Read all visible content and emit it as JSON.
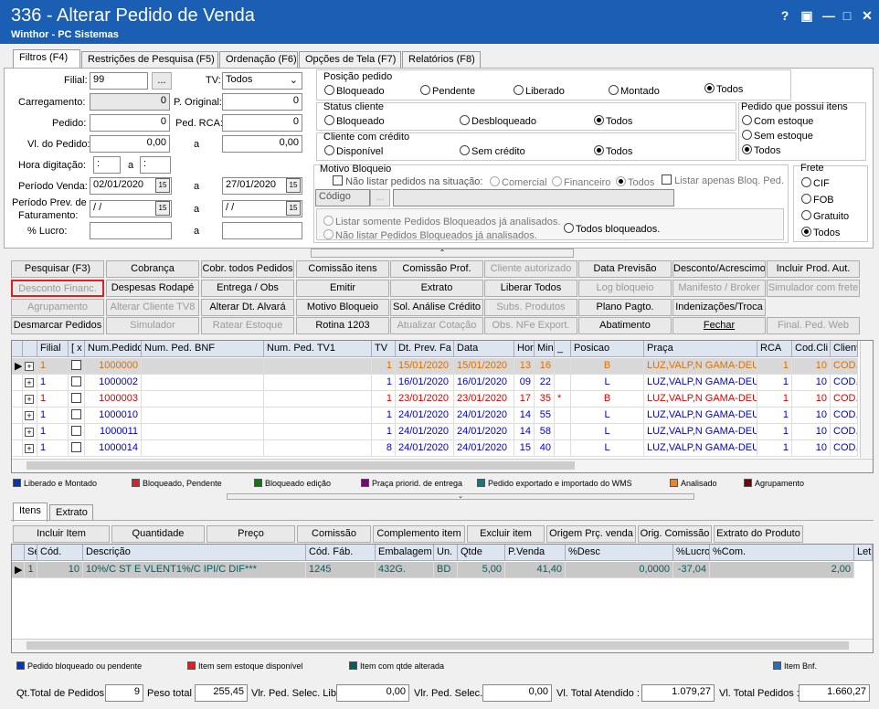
{
  "window": {
    "title": "336 - Alterar Pedido de Venda",
    "subtitle": "Winthor - PC Sistemas",
    "btn_help": "?",
    "btn_restore": "▣",
    "btn_min": "—",
    "btn_max": "□",
    "btn_close": "✕"
  },
  "tabs": [
    "Filtros (F4)",
    "Restrições de Pesquisa (F5)",
    "Ordenação (F6)",
    "Opções de Tela (F7)",
    "Relatórios (F8)"
  ],
  "filters": {
    "filial_label": "Filial:",
    "filial_value": "99",
    "filial_btn": "...",
    "tv_label": "TV:",
    "tv_value": "Todos",
    "carregamento_label": "Carregamento:",
    "carregamento_value": "0",
    "poriginal_label": "P. Original:",
    "poriginal_value": "0",
    "pedido_label": "Pedido:",
    "pedido_value": "0",
    "pedrca_label": "Ped. RCA:",
    "pedrca_value": "0",
    "vlpedido_label": "Vl. do Pedido:",
    "vlpedido_from": "0,00",
    "vlpedido_to": "0,00",
    "a": "a",
    "hora_label": "Hora digitação:",
    "hora_from": ":",
    "hora_to": ":",
    "periodo_label": "Período Venda:",
    "periodo_from": "02/01/2020",
    "periodo_to": "27/01/2020",
    "prev_label1": "Período Prev. de",
    "prev_label2": "Faturamento:",
    "prev_from": "/ /",
    "prev_to": "/ /",
    "lucro_label": "% Lucro:"
  },
  "posicao": {
    "title": "Posição pedido",
    "options": [
      "Bloqueado",
      "Pendente",
      "Liberado",
      "Montado",
      "Todos"
    ],
    "selected": 4
  },
  "status_cliente": {
    "title": "Status cliente",
    "options": [
      "Bloqueado",
      "Desbloqueado",
      "Todos"
    ]
  },
  "credito": {
    "title": "Cliente com crédito",
    "options": [
      "Disponível",
      "Sem crédito",
      "Todos"
    ]
  },
  "possui_itens": {
    "title": "Pedido que possui itens",
    "options": [
      "Com estoque",
      "Sem estoque",
      "Todos"
    ]
  },
  "motivo": {
    "title": "Motivo Bloqueio",
    "nao_listar": "Não listar pedidos na situação:",
    "opts": [
      "Comercial",
      "Financeiro",
      "Todos"
    ],
    "listar_apenas": "Listar apenas Bloq. Ped.",
    "codigo": "Código",
    "btn": "...",
    "somente": "Listar somente Pedidos Bloqueados já analisados.",
    "nao_listar_analisados": "Não listar Pedidos Bloqueados já analisados.",
    "todos_bloq": "Todos bloqueados."
  },
  "frete": {
    "title": "Frete",
    "options": [
      "CIF",
      "FOB",
      "Gratuito",
      "Todos"
    ]
  },
  "buttons": [
    [
      "Pesquisar (F3)",
      "Cobrança",
      "Cobr. todos Pedidos",
      "Comissão itens",
      "Comissão Prof.",
      "Cliente autorizado",
      "Data Previsão",
      "Desconto/Acrescimo",
      "Incluir Prod. Aut."
    ],
    [
      "Desconto Financ.",
      "Despesas Rodapé",
      "Entrega / Obs",
      "Emitir",
      "Extrato",
      "Liberar Todos",
      "Log bloqueio",
      "Manifesto / Broker",
      "Simulador com frete"
    ],
    [
      "Agrupamento",
      "Alterar Cliente TV8",
      "Alterar Dt. Alvará",
      "Motivo Bloqueio",
      "Sol. Análise Crédito",
      "Subs. Produtos",
      "Plano Pagto.",
      "Indenizações/Troca",
      ""
    ],
    [
      "Desmarcar Pedidos",
      "Simulador",
      "Ratear Estoque",
      "Rotina 1203",
      "Atualizar Cotação",
      "Obs. NFe Export.",
      "Abatimento",
      "Fechar",
      "Final. Ped. Web"
    ]
  ],
  "grid1": {
    "headers": [
      "Filial",
      "[ x ]",
      "Num.Pedido",
      "Num. Ped. BNF",
      "Num. Ped. TV1",
      "TV",
      "Dt. Prev. Fa",
      "Data",
      "Hor",
      "Min",
      "_",
      "Posicao",
      "Praça",
      "RCA",
      "Cod.Cli",
      "Client"
    ],
    "rows": [
      {
        "filial": "1",
        "num": "1000000",
        "tv": "1",
        "dtprev": "15/01/2020",
        "data": "15/01/2020",
        "hor": "13",
        "min": "16",
        "flag": "",
        "pos": "B",
        "praca": "LUZ,VALP,N GAMA-DEUS",
        "rca": "1",
        "codcli": "10",
        "cli": "COD."
      },
      {
        "filial": "1",
        "num": "1000002",
        "tv": "1",
        "dtprev": "16/01/2020",
        "data": "16/01/2020",
        "hor": "09",
        "min": "22",
        "flag": "",
        "pos": "L",
        "praca": "LUZ,VALP,N GAMA-DEUS",
        "rca": "1",
        "codcli": "10",
        "cli": "COD."
      },
      {
        "filial": "1",
        "num": "1000003",
        "tv": "1",
        "dtprev": "23/01/2020",
        "data": "23/01/2020",
        "hor": "17",
        "min": "35",
        "flag": "*",
        "pos": "B",
        "praca": "LUZ,VALP,N GAMA-DEUS",
        "rca": "1",
        "codcli": "10",
        "cli": "COD."
      },
      {
        "filial": "1",
        "num": "1000010",
        "tv": "1",
        "dtprev": "24/01/2020",
        "data": "24/01/2020",
        "hor": "14",
        "min": "55",
        "flag": "",
        "pos": "L",
        "praca": "LUZ,VALP,N GAMA-DEUS",
        "rca": "1",
        "codcli": "10",
        "cli": "COD."
      },
      {
        "filial": "1",
        "num": "1000011",
        "tv": "1",
        "dtprev": "24/01/2020",
        "data": "24/01/2020",
        "hor": "14",
        "min": "58",
        "flag": "",
        "pos": "L",
        "praca": "LUZ,VALP,N GAMA-DEUS",
        "rca": "1",
        "codcli": "10",
        "cli": "COD."
      },
      {
        "filial": "1",
        "num": "1000014",
        "tv": "8",
        "dtprev": "24/01/2020",
        "data": "24/01/2020",
        "hor": "15",
        "min": "40",
        "flag": "",
        "pos": "L",
        "praca": "LUZ,VALP,N GAMA-DEUS",
        "rca": "1",
        "codcli": "10",
        "cli": "COD."
      }
    ],
    "row_colors": [
      "#e07000",
      "#0000cc",
      "#e00000",
      "#0000cc",
      "#0000cc",
      "#0000cc"
    ]
  },
  "legend1": [
    {
      "label": "Liberado e Montado",
      "color": "#0033cc"
    },
    {
      "label": "Bloqueado, Pendente",
      "color": "#e02020"
    },
    {
      "label": "Bloqueado edição",
      "color": "#008000"
    },
    {
      "label": "Praça priorid. de entrega",
      "color": "#800080"
    },
    {
      "label": "Pedido exportado e importado do WMS",
      "color": "#008080"
    },
    {
      "label": "Analisado",
      "color": "#f08020"
    },
    {
      "label": "Agrupamento",
      "color": "#800000"
    }
  ],
  "itemtabs": [
    "Itens",
    "Extrato"
  ],
  "itembuttons": [
    "Incluir Item",
    "Quantidade",
    "Preço",
    "Comissão",
    "Complemento item",
    "Excluir item",
    "Origem Prç. venda",
    "Orig. Comissão",
    "Extrato do Produto"
  ],
  "grid2": {
    "headers": [
      "Sec",
      "Cód.",
      "Descrição",
      "Cód. Fáb.",
      "Embalagem",
      "Un.",
      "Qtde",
      "P.Venda",
      "%Desc",
      "%Lucro",
      "%Com.",
      "Let"
    ],
    "row": {
      "sec": "1",
      "cod": "10",
      "desc": "10%/C ST E VLENT1%/C IPI/C DIF***",
      "fab": "1245",
      "emb": "432G.",
      "un": "BD",
      "qtde": "5,00",
      "pvenda": "41,40",
      "desc_pct": "0,0000",
      "lucro": "-37,04",
      "com": "2,00"
    }
  },
  "legend2": [
    {
      "label": "Pedido bloqueado ou pendente",
      "color": "#0033cc"
    },
    {
      "label": "Item sem estoque disponível",
      "color": "#e02020"
    },
    {
      "label": "Item com qtde alterada",
      "color": "#006060"
    },
    {
      "label": "Item Bnf.",
      "color": "#1e6fd0"
    }
  ],
  "footer": {
    "qt_label": "Qt.Total de Pedidos",
    "qt_value": "9",
    "peso_label": "Peso total",
    "peso_value": "255,45",
    "vllib_label": "Vlr. Ped. Selec. Lib.",
    "vllib_value": "0,00",
    "vlsel_label": "Vlr. Ped. Selec.",
    "vlsel_value": "0,00",
    "vlat_label": "Vl. Total Atendido :",
    "vlat_value": "1.079,27",
    "vltp_label": "Vl. Total Pedidos :",
    "vltp_value": "1.660,27"
  }
}
